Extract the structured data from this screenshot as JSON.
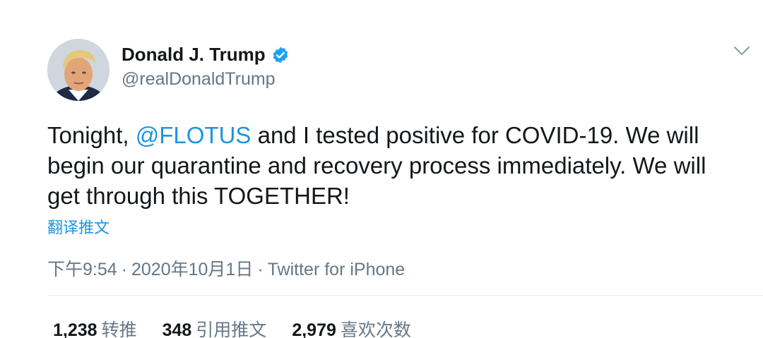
{
  "user": {
    "display_name": "Donald J. Trump",
    "handle": "@realDonaldTrump",
    "verified": true
  },
  "tweet": {
    "text_before_mention": "Tonight, ",
    "mention": "@FLOTUS",
    "text_after_mention": " and I tested positive for COVID-19. We will\nbegin our quarantine and recovery process immediately. We will\nget through this TOGETHER!",
    "translate_label": "翻译推文"
  },
  "meta": {
    "time": "下午9:54",
    "separator": "·",
    "date": "2020年10月1日",
    "source": "Twitter for iPhone"
  },
  "stats": {
    "retweets": {
      "count": "1,238",
      "label": "转推"
    },
    "quotes": {
      "count": "348",
      "label": "引用推文"
    },
    "likes": {
      "count": "2,979",
      "label": "喜欢次数"
    }
  },
  "colors": {
    "link": "#1b95e0",
    "secondary_text": "#657786",
    "verified_badge": "#1da1f2"
  },
  "icons": {
    "verified": "verified-badge-icon",
    "more": "chevron-down-icon"
  }
}
